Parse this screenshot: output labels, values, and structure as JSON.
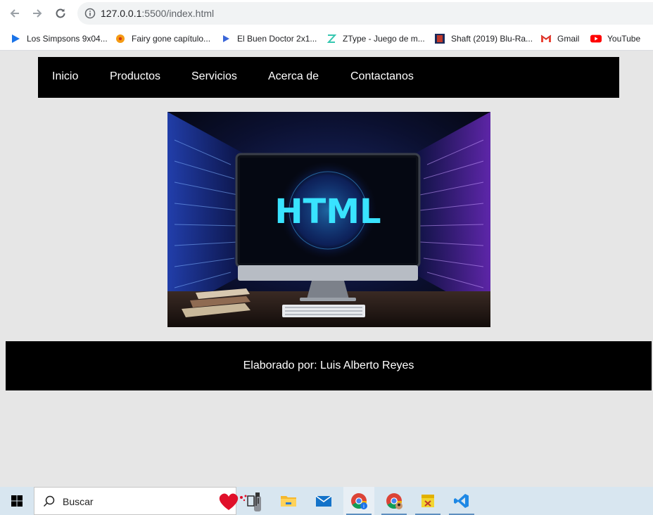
{
  "browser": {
    "url_host": "127.0.0.1",
    "url_path": ":5500/index.html",
    "bookmarks": [
      {
        "label": "Los Simpsons 9x04...",
        "icon": "play-triangle-icon"
      },
      {
        "label": "Fairy gone capítulo...",
        "icon": "dragonball-icon"
      },
      {
        "label": "El Buen Doctor 2x1...",
        "icon": "play-triangle-icon"
      },
      {
        "label": "ZType - Juego de m...",
        "icon": "ztype-icon"
      },
      {
        "label": "Shaft (2019) Blu-Ra...",
        "icon": "movie-thumbnail-icon"
      },
      {
        "label": "Gmail",
        "icon": "gmail-icon"
      },
      {
        "label": "YouTube",
        "icon": "youtube-icon"
      }
    ]
  },
  "page": {
    "menu": [
      "Inicio",
      "Productos",
      "Servicios",
      "Acerca de",
      "Contactanos"
    ],
    "hero_text": "HTML",
    "footer_text": "Elaborado por: Luis Alberto Reyes"
  },
  "taskbar": {
    "search_placeholder": "Buscar",
    "apps": [
      "task-view",
      "file-explorer",
      "mail",
      "chrome",
      "chrome-profile",
      "sticky-app",
      "vscode"
    ]
  }
}
